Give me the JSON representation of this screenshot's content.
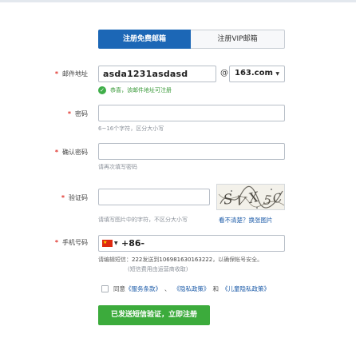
{
  "tabs": [
    {
      "label": "注册免费邮箱",
      "active": true
    },
    {
      "label": "注册VIP邮箱",
      "active": false
    }
  ],
  "form": {
    "required_mark": "*",
    "email": {
      "label": "邮件地址",
      "value": "asda1231asdasd",
      "at": "@",
      "domain": "163.com",
      "ok_text": "恭喜，该邮件地址可注册"
    },
    "password": {
      "label": "密码",
      "value": "",
      "hint": "6~16个字符，区分大小写"
    },
    "confirm": {
      "label": "确认密码",
      "value": "",
      "hint": "请再次填写密码"
    },
    "captcha": {
      "label": "验证码",
      "value": "",
      "hint": "请填写图片中的字符，不区分大小写",
      "refresh_label": "看不清楚？换张图片"
    },
    "phone": {
      "label": "手机号码",
      "country_code": "+86-",
      "value": "",
      "sms_prefix": "请编辑短信：",
      "sms_code": "222",
      "sms_mid": "发送到",
      "sms_number": "106981630163222",
      "sms_suffix": "，以确保帐号安全。",
      "sms_sub": "(短信费用由运营商收取)"
    }
  },
  "agreement": {
    "prefix": "同意",
    "terms": "《服务条款》",
    "sep": "、",
    "privacy": "《隐私政策》",
    "and": "和",
    "children": "《儿童隐私政策》"
  },
  "submit_label": "已发送短信验证，立即注册",
  "colors": {
    "tab_active": "#1c67b6",
    "required": "#e0342d",
    "success": "#3fae49",
    "link": "#1c5ba8",
    "submit": "#3cab3c"
  },
  "icons": [
    "check-circle-icon",
    "china-flag-icon",
    "chevron-down-icon"
  ]
}
